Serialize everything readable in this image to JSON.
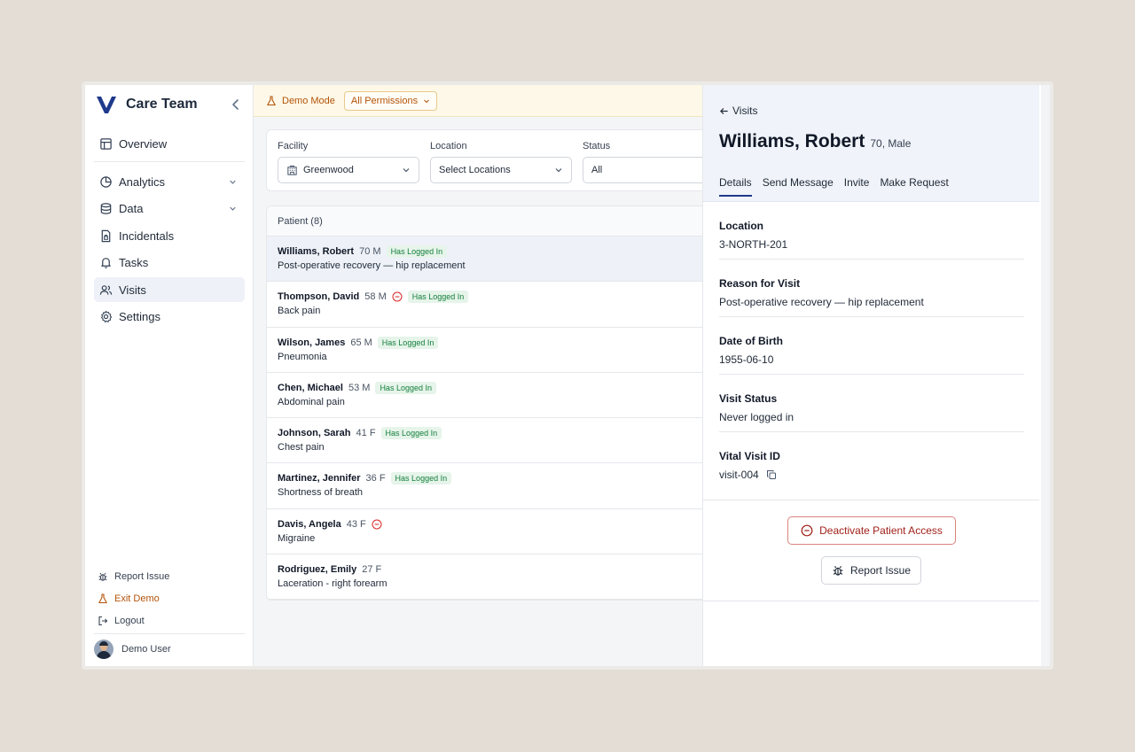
{
  "app": {
    "name": "Care Team"
  },
  "sidebar": {
    "nav": [
      {
        "label": "Overview",
        "icon": "layout-icon"
      },
      {
        "label": "Analytics",
        "icon": "pie-chart-icon",
        "expandable": true
      },
      {
        "label": "Data",
        "icon": "database-icon",
        "expandable": true
      },
      {
        "label": "Incidentals",
        "icon": "file-lock-icon"
      },
      {
        "label": "Tasks",
        "icon": "bell-icon"
      },
      {
        "label": "Visits",
        "icon": "users-icon",
        "active": true
      },
      {
        "label": "Settings",
        "icon": "gear-icon"
      }
    ],
    "bottom": {
      "report_issue": "Report Issue",
      "exit_demo": "Exit Demo",
      "logout": "Logout"
    },
    "user": {
      "name": "Demo User"
    }
  },
  "demo": {
    "label": "Demo Mode",
    "permissions": "All Permissions"
  },
  "filters": {
    "facility": {
      "label": "Facility",
      "value": "Greenwood"
    },
    "location": {
      "label": "Location",
      "value": "Select Locations"
    },
    "status": {
      "label": "Status",
      "value": "All"
    }
  },
  "patients": {
    "header": "Patient (8)",
    "rows": [
      {
        "name": "Williams, Robert",
        "age": "70 M",
        "deactivated": false,
        "badge": "Has Logged In",
        "reason": "Post-operative recovery — hip replacement",
        "selected": true
      },
      {
        "name": "Thompson, David",
        "age": "58 M",
        "deactivated": true,
        "badge": "Has Logged In",
        "reason": "Back pain"
      },
      {
        "name": "Wilson, James",
        "age": "65 M",
        "deactivated": false,
        "badge": "Has Logged In",
        "reason": "Pneumonia"
      },
      {
        "name": "Chen, Michael",
        "age": "53 M",
        "deactivated": false,
        "badge": "Has Logged In",
        "reason": "Abdominal pain"
      },
      {
        "name": "Johnson, Sarah",
        "age": "41 F",
        "deactivated": false,
        "badge": "Has Logged In",
        "reason": "Chest pain"
      },
      {
        "name": "Martinez, Jennifer",
        "age": "36 F",
        "deactivated": false,
        "badge": "Has Logged In",
        "reason": "Shortness of breath"
      },
      {
        "name": "Davis, Angela",
        "age": "43 F",
        "deactivated": true,
        "badge": "",
        "reason": "Migraine"
      },
      {
        "name": "Rodriguez, Emily",
        "age": "27 F",
        "deactivated": false,
        "badge": "",
        "reason": "Laceration - right forearm"
      }
    ]
  },
  "detail": {
    "back": "Visits",
    "name": "Williams, Robert",
    "meta": "70, Male",
    "tabs": [
      "Details",
      "Send Message",
      "Invite",
      "Make Request"
    ],
    "fields": [
      {
        "label": "Location",
        "value": "3-NORTH-201"
      },
      {
        "label": "Reason for Visit",
        "value": "Post-operative recovery — hip replacement"
      },
      {
        "label": "Date of Birth",
        "value": "1955-06-10"
      },
      {
        "label": "Visit Status",
        "value": "Never logged in"
      },
      {
        "label": "Vital Visit ID",
        "value": "visit-004",
        "copyable": true
      }
    ],
    "deactivate_label": "Deactivate Patient Access",
    "report_label": "Report Issue"
  },
  "colors": {
    "brand": "#1e3a8a",
    "demo_accent": "#b45309",
    "badge_bg": "#e6f4ea",
    "badge_text": "#15803d",
    "danger": "#9f1d16"
  }
}
